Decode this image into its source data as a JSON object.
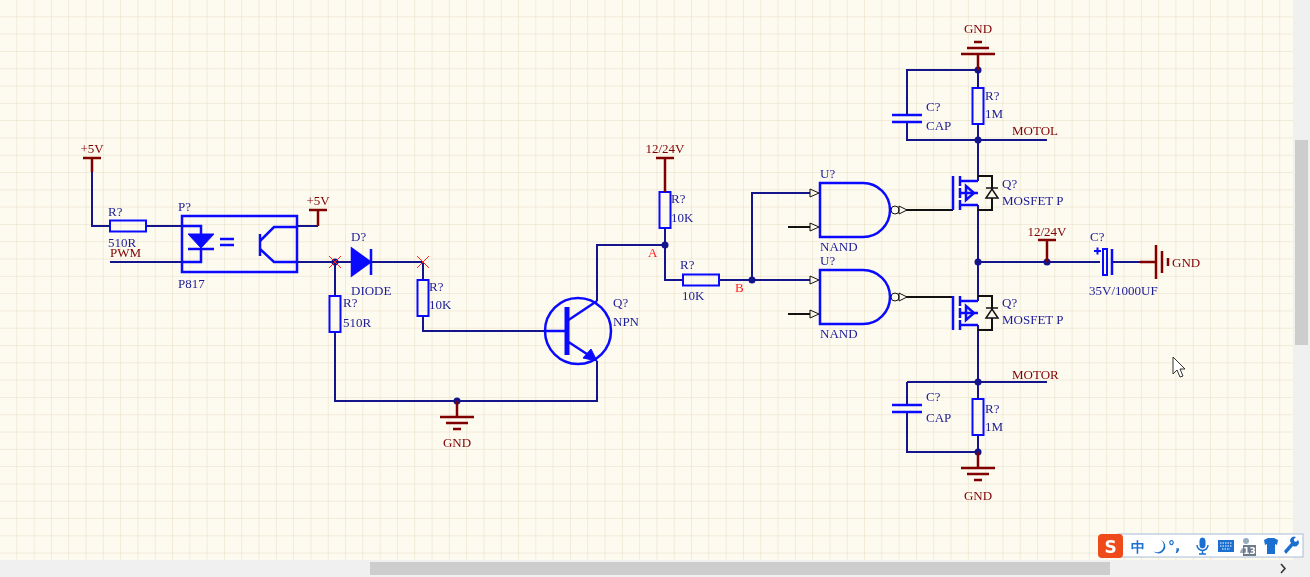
{
  "components": [
    {
      "kind": "resistor",
      "designator": "R?",
      "value": "510R"
    },
    {
      "kind": "optocoupler",
      "designator": "P?",
      "value": "P817"
    },
    {
      "kind": "diode",
      "designator": "D?",
      "value": "DIODE"
    },
    {
      "kind": "resistor",
      "designator": "R?",
      "value": "510R"
    },
    {
      "kind": "resistor",
      "designator": "R?",
      "value": "10K"
    },
    {
      "kind": "npn",
      "designator": "Q?",
      "value": "NPN"
    },
    {
      "kind": "resistor",
      "designator": "R?",
      "value": "10K"
    },
    {
      "kind": "resistor",
      "designator": "R?",
      "value": "10K"
    },
    {
      "kind": "nand",
      "designator": "U?",
      "value": "NAND"
    },
    {
      "kind": "nand",
      "designator": "U?",
      "value": "NAND"
    },
    {
      "kind": "pmos",
      "designator": "Q?",
      "value": "MOSFET P"
    },
    {
      "kind": "pmos",
      "designator": "Q?",
      "value": "MOSFET P"
    },
    {
      "kind": "capacitor",
      "designator": "C?",
      "value": "CAP"
    },
    {
      "kind": "resistor",
      "designator": "R?",
      "value": "1M"
    },
    {
      "kind": "electrolytic",
      "designator": "C?",
      "value": "35V/1000UF"
    },
    {
      "kind": "capacitor",
      "designator": "C?",
      "value": "CAP"
    },
    {
      "kind": "resistor",
      "designator": "R?",
      "value": "1M"
    }
  ],
  "power_ports": [
    {
      "kind": "power",
      "label": "+5V"
    },
    {
      "kind": "power",
      "label": "+5V"
    },
    {
      "kind": "power",
      "label": "12/24V"
    },
    {
      "kind": "power",
      "label": "12/24V"
    },
    {
      "kind": "ground",
      "label": "GND"
    },
    {
      "kind": "ground",
      "label": "GND"
    },
    {
      "kind": "ground",
      "label": "GND"
    },
    {
      "kind": "ground",
      "label": "GND"
    }
  ],
  "net_labels": [
    "PWM",
    "MOTOL",
    "MOTOR"
  ],
  "node_labels": [
    "A",
    "B"
  ],
  "ime_toolbar": {
    "logo": "S",
    "mode": "中",
    "punctuation": "°,",
    "badge": "13"
  }
}
